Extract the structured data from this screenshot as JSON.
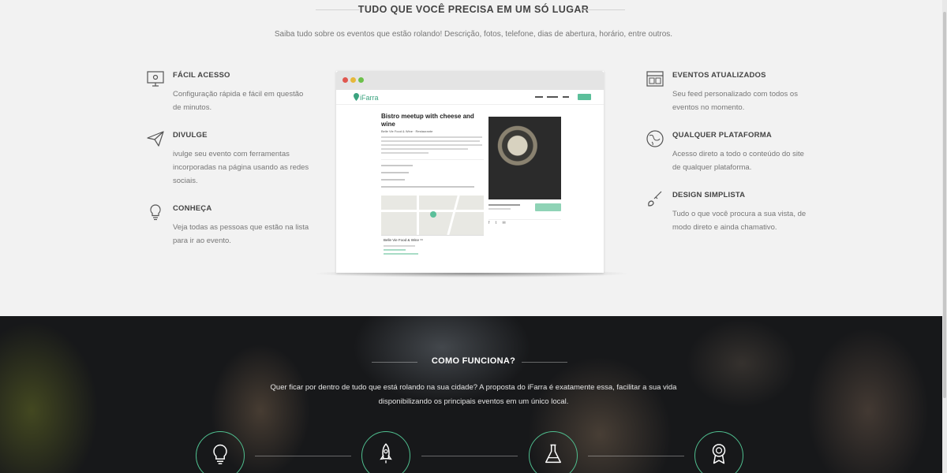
{
  "section_top": {
    "title": "TUDO QUE VOCÊ PRECISA EM UM SÓ LUGAR",
    "subtitle": "Saiba tudo sobre os eventos que estão rolando! Descrição, fotos, telefone, dias de abertura, horário, entre outros."
  },
  "features_left": [
    {
      "icon": "monitor-icon",
      "title": "FÁCIL ACESSO",
      "text": "Configuração rápida e fácil em questão de minutos."
    },
    {
      "icon": "paper-plane-icon",
      "title": "DIVULGE",
      "text": "ivulge seu evento com ferramentas incorporadas na página usando as redes sociais."
    },
    {
      "icon": "lightbulb-icon",
      "title": "CONHEÇA",
      "text": "Veja todas as pessoas que estão na lista para ir ao evento."
    }
  ],
  "features_right": [
    {
      "icon": "layout-icon",
      "title": "EVENTOS ATUALIZADOS",
      "text": "Seu feed personalizado com todos os eventos no momento."
    },
    {
      "icon": "globe-icon",
      "title": "QUALQUER PLATAFORMA",
      "text": "Acesso direto a todo o conteúdo do site de qualquer plataforma."
    },
    {
      "icon": "brush-icon",
      "title": "DESIGN SIMPLISTA",
      "text": "Tudo o que você procura a sua vista, de modo direto e ainda chamativo."
    }
  ],
  "mockup": {
    "logo": "iFarra",
    "event_title": "Bistro meetup with cheese and wine",
    "event_org": "Belle Vie Food & Wine  ·  Restaurante",
    "venue_name": "Belle Vie Food & Wine ⁹⁹"
  },
  "section_bottom": {
    "title": "COMO FUNCIONA?",
    "text": "Quer ficar por dentro de tudo que está rolando na sua cidade? A proposta do iFarra é exatamente essa, facilitar a sua vida disponibilizando os principais eventos em um único local.",
    "steps": [
      "lightbulb-icon",
      "rocket-icon",
      "flask-icon",
      "award-icon"
    ]
  },
  "colors": {
    "accent": "#4fbf8f",
    "dark_bg": "#17181a",
    "light_bg": "#f2f2f2"
  }
}
